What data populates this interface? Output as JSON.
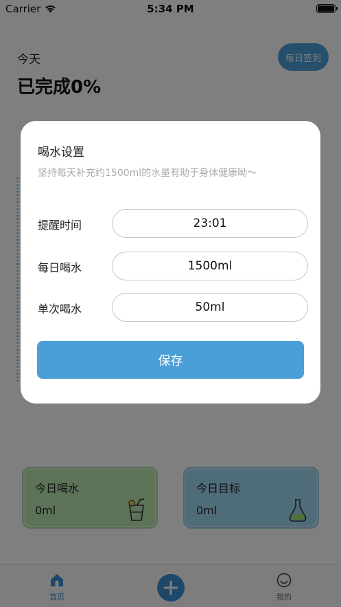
{
  "status_bar": {
    "carrier": "Carrier",
    "time": "5:34 PM"
  },
  "header": {
    "today": "今天",
    "completed": "已完成0%",
    "checkin_label": "每日签到"
  },
  "cards": {
    "water": {
      "title": "今日喝水",
      "value": "0ml",
      "icon": "drink-cup-icon"
    },
    "goal": {
      "title": "今日目标",
      "value": "0ml",
      "icon": "flask-icon"
    }
  },
  "tab_bar": {
    "home_label": "首页",
    "mine_label": "我的",
    "add_icon": "plus-icon"
  },
  "modal": {
    "title": "喝水设置",
    "description": "坚持每天补充约1500ml的水量有助于身体健康呦～",
    "fields": [
      {
        "label": "提醒时间",
        "value": "23:01"
      },
      {
        "label": "每日喝水",
        "value": "1500ml"
      },
      {
        "label": "单次喝水",
        "value": "50ml"
      }
    ],
    "save_label": "保存"
  },
  "colors": {
    "accent": "#4a9fd6",
    "tab_active": "#3e8ed0",
    "card_water": "#b8e6b0",
    "card_goal": "#9ed8f2"
  }
}
